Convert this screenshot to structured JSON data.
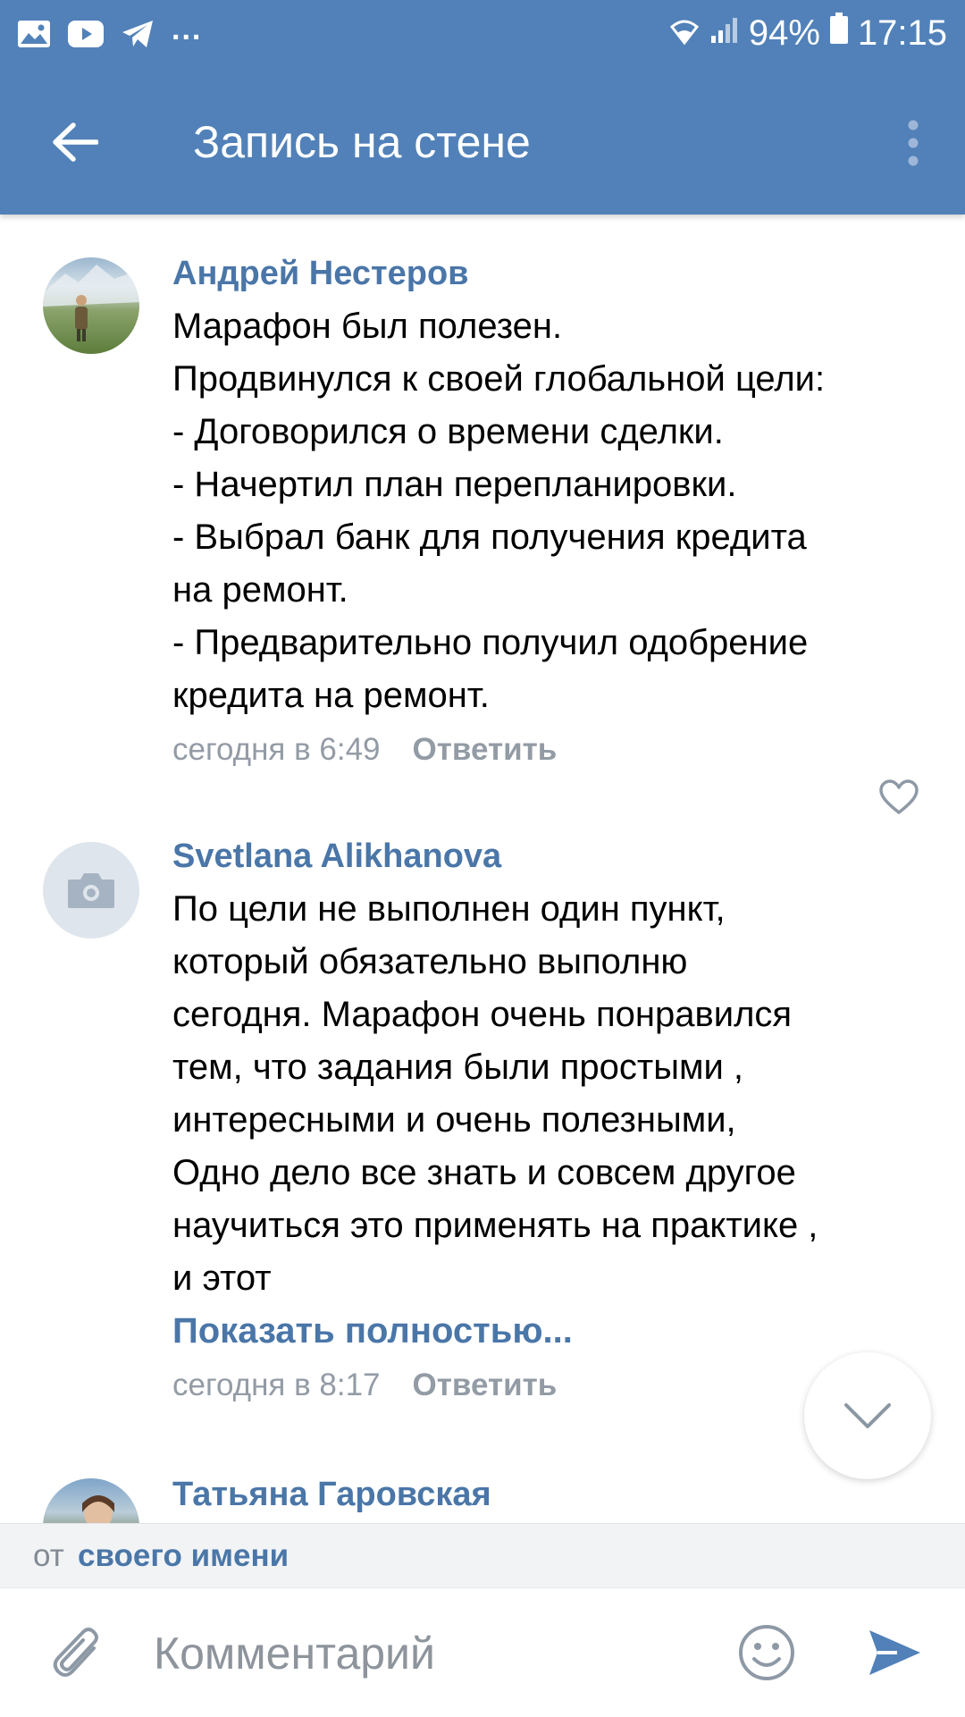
{
  "colors": {
    "header_bg": "#5181b8",
    "link_blue": "#4a76a8",
    "meta_gray": "#939ba5"
  },
  "statusbar": {
    "left_icons": [
      "image-icon",
      "youtube-icon",
      "telegram-icon"
    ],
    "more": "...",
    "battery": "94%",
    "time": "17:15"
  },
  "toolbar": {
    "title": "Запись на стене"
  },
  "comments": [
    {
      "author": "Андрей Нестеров",
      "lines": [
        "Марафон был полезен.",
        "Продвинулся к своей глобальной цели:",
        "- Договорился о времени сделки.",
        "- Начертил план перепланировки.",
        "- Выбрал банк для получения кредита",
        "на ремонт.",
        "- Предварительно получил одобрение",
        "кредита на ремонт."
      ],
      "time": "сегодня в 6:49",
      "reply": "Ответить"
    },
    {
      "author": "Svetlana Alikhanova",
      "lines": [
        "По цели не выполнен один пункт,",
        "который обязательно выполню",
        "сегодня. Марафон очень понравился",
        "тем, что задания были простыми ,",
        "интересными и очень полезными,",
        "Одно дело все знать и совсем другое",
        "научиться это применять на практике ,",
        "и этот"
      ],
      "show_more": "Показать полностью...",
      "time": "сегодня в 8:17",
      "reply": "Ответить"
    },
    {
      "author": "Татьяна Гаровская"
    }
  ],
  "as_bar": {
    "prefix": "от",
    "link": "своего имени"
  },
  "composer": {
    "placeholder": "Комментарий"
  }
}
